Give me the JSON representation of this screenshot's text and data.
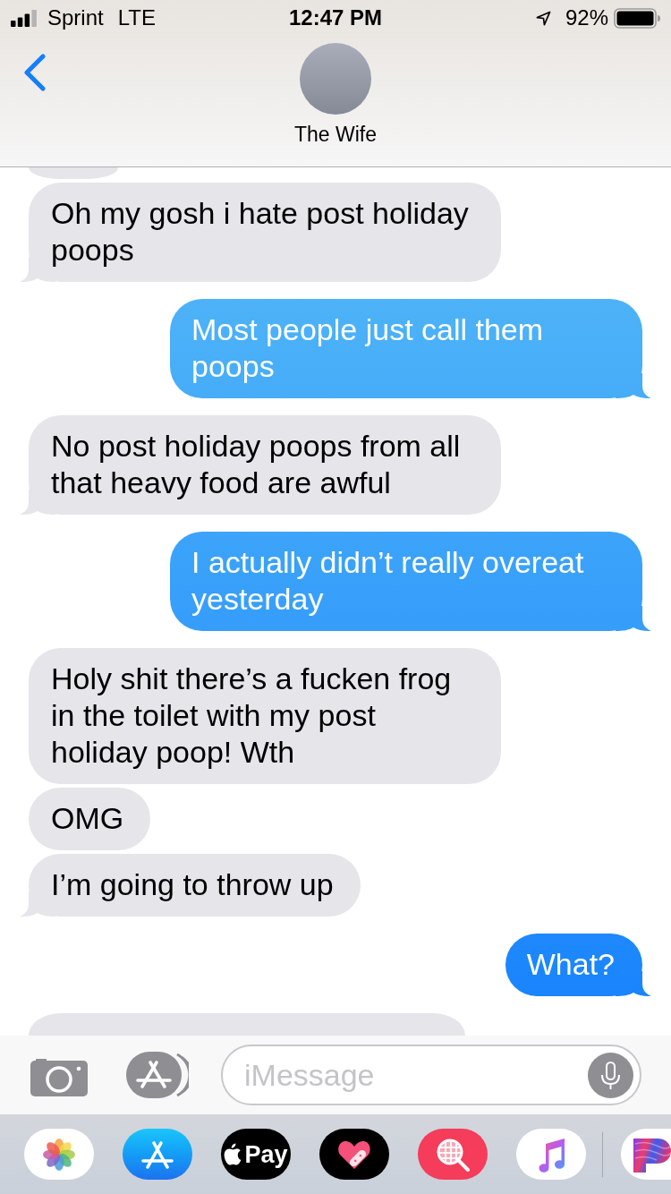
{
  "status_bar": {
    "carrier": "Sprint",
    "network": "LTE",
    "time": "12:47 PM",
    "battery_percent": "92%"
  },
  "header": {
    "contact": "The Wife"
  },
  "messages": [
    {
      "kind": "clipped",
      "outgoing": false,
      "tail": false
    },
    {
      "kind": "full",
      "outgoing": false,
      "text": "Oh my gosh i hate post holiday poops",
      "tail": true
    },
    {
      "kind": "full",
      "outgoing": true,
      "text": "Most people just call them poops",
      "tail": true
    },
    {
      "kind": "full",
      "outgoing": false,
      "text": "No post holiday poops from all that heavy food are awful",
      "tail": true
    },
    {
      "kind": "full",
      "outgoing": true,
      "text": "I actually didn’t really overeat yesterday",
      "tail": true
    },
    {
      "kind": "full",
      "outgoing": false,
      "text": "Holy shit there’s a fucken frog in the toilet with my post holiday poop! Wth",
      "tail": false
    },
    {
      "kind": "full",
      "outgoing": false,
      "text": "OMG",
      "tail": false
    },
    {
      "kind": "full",
      "outgoing": false,
      "text": "I’m going to throw up",
      "tail": true
    },
    {
      "kind": "full",
      "outgoing": true,
      "text": "What?",
      "tail": true
    },
    {
      "kind": "clipped",
      "outgoing": false,
      "tail": false
    }
  ],
  "compose": {
    "placeholder": "iMessage"
  },
  "app_drawer": [
    {
      "kind": "photos"
    },
    {
      "kind": "store"
    },
    {
      "kind": "pay",
      "label": "Pay"
    },
    {
      "kind": "heart"
    },
    {
      "kind": "search"
    },
    {
      "kind": "music"
    },
    {
      "kind": "partial"
    }
  ]
}
